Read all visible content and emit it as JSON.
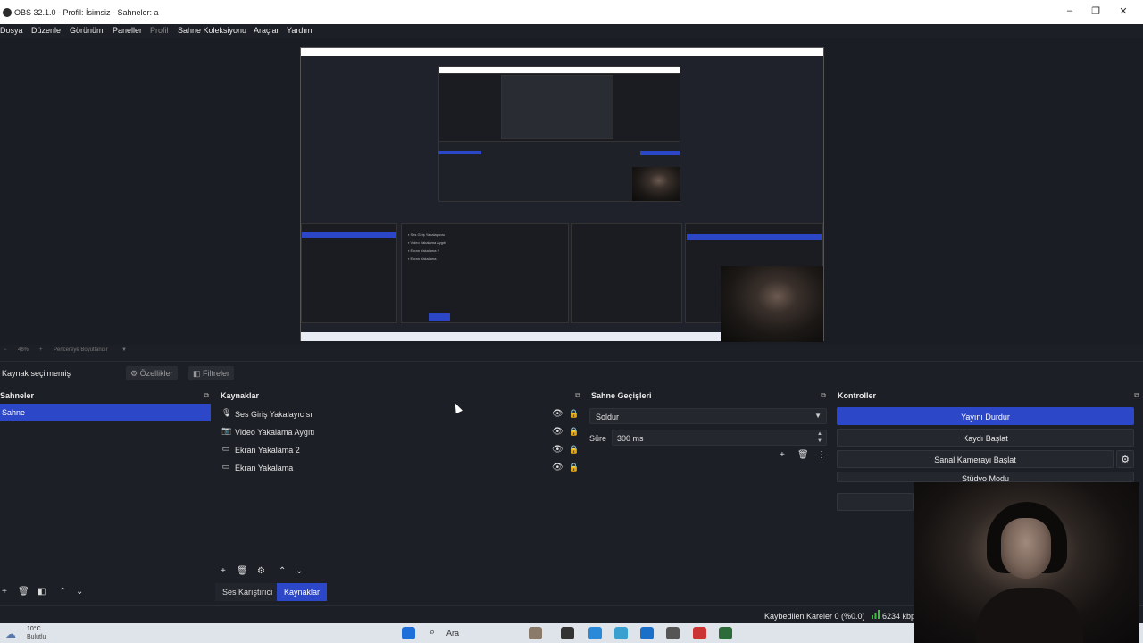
{
  "window": {
    "title": "OBS 32.1.0 - Profil: İsimsiz - Sahneler: a",
    "minimize": "–",
    "maximize": "❐",
    "close": "✕"
  },
  "menu": [
    "Dosya",
    "Düzenle",
    "Görünüm",
    "Paneller",
    "Profil",
    "Sahne Koleksiyonu",
    "Araçlar",
    "Yardım"
  ],
  "zoom": {
    "percent": "46%",
    "mode": "Pencereye Boyutlandır"
  },
  "source_toolbar": {
    "no_selection": "Kaynak seçilmemiş",
    "properties": "Özellikler",
    "filters": "Filtreler"
  },
  "scenes": {
    "title": "Sahneler",
    "items": [
      "Sahne"
    ]
  },
  "sources": {
    "title": "Kaynaklar",
    "items": [
      {
        "label": "Ses Giriş Yakalayıcısı",
        "icon": "microphone-icon"
      },
      {
        "label": "Video Yakalama Aygıtı",
        "icon": "camera-icon"
      },
      {
        "label": "Ekran Yakalama 2",
        "icon": "monitor-icon"
      },
      {
        "label": "Ekran Yakalama",
        "icon": "monitor-icon"
      }
    ]
  },
  "dock_tabs": {
    "mixer": "Ses Karıştırıcı",
    "sources": "Kaynaklar"
  },
  "transitions": {
    "title": "Sahne Geçişleri",
    "selected": "Soldur",
    "duration_label": "Süre",
    "duration_value": "300 ms"
  },
  "controls": {
    "title": "Kontroller",
    "stop_stream": "Yayını Durdur",
    "start_recording": "Kaydı Başlat",
    "start_virtual_cam": "Sanal Kamerayı Başlat",
    "studio_mode": "Stüdyo Modu"
  },
  "status": {
    "dropped_frames": "Kaybedilen Kareler 0 (%0.0)",
    "bitrate": "6234 kbp"
  },
  "taskbar": {
    "temperature": "10°C",
    "condition": "Bulutlu",
    "search": "Ara"
  },
  "colors": {
    "accent": "#2c47c8",
    "background": "#1d1f26",
    "signal": "#3fbf3f"
  }
}
